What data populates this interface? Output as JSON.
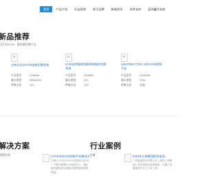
{
  "nav": {
    "items": [
      "首页",
      "产品介绍",
      "行业案例",
      "关于品牌",
      "新闻资讯",
      "技术支持",
      "蓝鸿鑫华务部"
    ]
  },
  "products_section": {
    "title": "新品推荐",
    "subtitle": "全行业KVM、服务器切换产品"
  },
  "products": [
    {
      "name": "分布式光纤KVM坐席切换系统",
      "specs": [
        {
          "label": "产品型号",
          "value": "DH6000"
        },
        {
          "label": "接口类型",
          "value": "HDMI/DVI"
        },
        {
          "label": "供电方式",
          "value": "12V"
        }
      ]
    },
    {
      "name": "KVM坐席管理切换系统服务切换系统",
      "specs": [
        {
          "label": "产品型号",
          "value": "DX8000"
        },
        {
          "label": "接口类型",
          "value": "DVI"
        },
        {
          "label": "供电方式",
          "value": "12V"
        }
      ]
    },
    {
      "name": "LB3378817寸KC LED KVM控制平台",
      "specs": [
        {
          "label": "产品型号",
          "value": "LB33788"
        },
        {
          "label": "接口类型",
          "value": "VGA"
        },
        {
          "label": "供电方式",
          "value": "交流"
        }
      ]
    }
  ],
  "solutions_section": {
    "title": "解决方案",
    "meta_label": "类别方式"
  },
  "solution": {
    "title": "CAT6LEDKVM控制平台解决方...",
    "text": "方案以CAT6LEDKVM控制平台作为一个集中管理KVM控制中心，通过服务器机房远程集中管理各服务器，提高..."
  },
  "cases_section": {
    "title": "行业案例"
  },
  "case": {
    "title": "2022年三峡集团股份省条...",
    "text": "三峡集团股份有限公司（简称三峡集团）是中国清洁能源集团，中国三峡集团依托长江三峡工程...",
    "meta_label": "作者"
  }
}
